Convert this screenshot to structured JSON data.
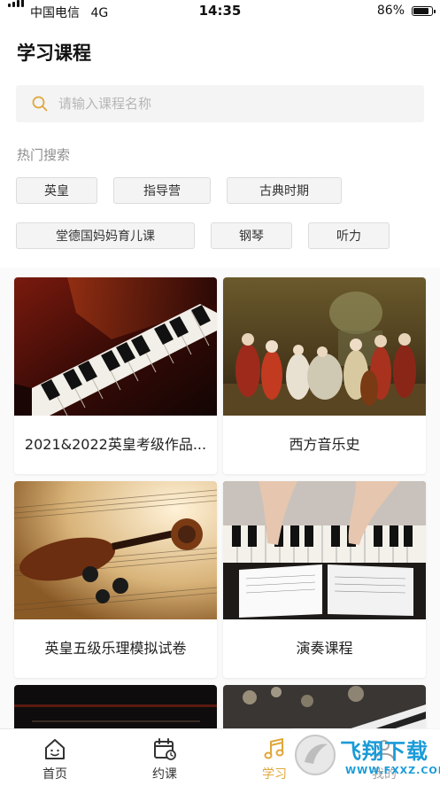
{
  "status_bar": {
    "carrier": "中国电信",
    "network": "4G",
    "time": "14:35",
    "battery": "86%",
    "battery_level": 0.86
  },
  "page": {
    "title": "学习课程"
  },
  "search": {
    "placeholder": "请输入课程名称"
  },
  "hot_search": {
    "title": "热门搜索",
    "tags": [
      "英皇",
      "指导营",
      "古典时期",
      "堂德国妈妈育儿课",
      "钢琴",
      "听力"
    ]
  },
  "courses": [
    {
      "title": "2021&2022英皇考级作品...",
      "image": "grand-piano-keys-image"
    },
    {
      "title": "西方音乐史",
      "image": "classical-painting-image"
    },
    {
      "title": "英皇五级乐理模拟试卷",
      "image": "violin-sheet-music-image"
    },
    {
      "title": "演奏课程",
      "image": "hands-on-piano-image"
    },
    {
      "title": "",
      "image": "dark-piano-image"
    },
    {
      "title": "",
      "image": "piano-bokeh-image"
    }
  ],
  "tab_bar": {
    "items": [
      {
        "label": "首页",
        "icon": "home-icon"
      },
      {
        "label": "约课",
        "icon": "calendar-icon"
      },
      {
        "label": "学习",
        "icon": "music-note-icon",
        "active": true
      },
      {
        "label": "我的",
        "icon": "profile-icon"
      }
    ]
  },
  "watermark": {
    "text": "飞翔下载",
    "url_text": "WWW.FXXZ.COM"
  },
  "colors": {
    "accent": "#e0a73c",
    "tag_bg": "#f4f4f4",
    "search_bg": "#f4f4f4"
  }
}
